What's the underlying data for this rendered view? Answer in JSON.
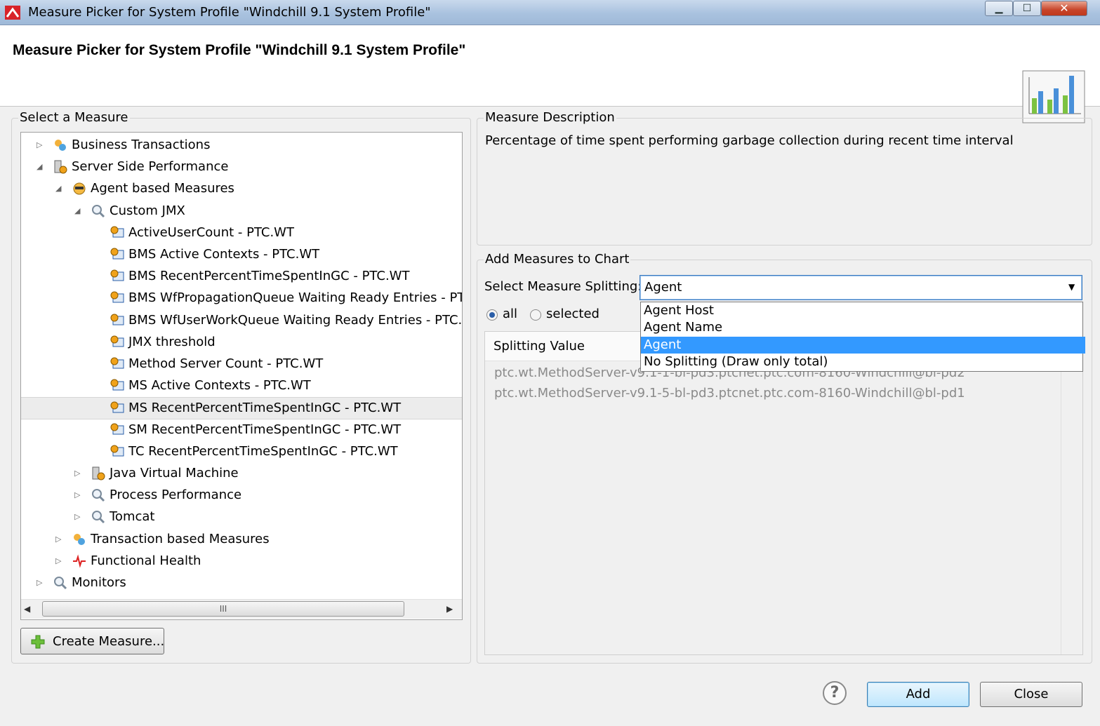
{
  "window": {
    "title": "Measure Picker for System Profile \"Windchill 9.1 System Profile\"",
    "controls": {
      "minimize": "▁",
      "maximize": "☐",
      "close": "✕"
    }
  },
  "header": {
    "title": "Measure Picker for System Profile \"Windchill 9.1 System Profile\"",
    "icon": "bar-chart-icon"
  },
  "select_measure": {
    "label": "Select a Measure",
    "tree": [
      {
        "label": "Business Transactions",
        "icon": "transactions-icon",
        "expanded": false
      },
      {
        "label": "Server Side Performance",
        "icon": "server-icon",
        "expanded": true
      },
      {
        "label": "Agent based Measures",
        "icon": "agent-icon",
        "expanded": true
      },
      {
        "label": "Custom JMX",
        "icon": "magnifier-icon",
        "expanded": true
      },
      {
        "label": "ActiveUserCount - PTC.WT",
        "icon": "jmx-measure-icon"
      },
      {
        "label": "BMS Active Contexts - PTC.WT",
        "icon": "jmx-measure-icon"
      },
      {
        "label": "BMS RecentPercentTimeSpentInGC - PTC.WT",
        "icon": "jmx-measure-icon"
      },
      {
        "label": "BMS WfPropagationQueue Waiting Ready Entries - PTC.WT",
        "icon": "jmx-measure-icon"
      },
      {
        "label": "BMS WfUserWorkQueue Waiting Ready Entries - PTC.WT",
        "icon": "jmx-measure-icon"
      },
      {
        "label": "JMX threshold",
        "icon": "jmx-measure-icon"
      },
      {
        "label": "Method Server Count - PTC.WT",
        "icon": "jmx-measure-icon"
      },
      {
        "label": "MS Active Contexts - PTC.WT",
        "icon": "jmx-measure-icon"
      },
      {
        "label": "MS RecentPercentTimeSpentInGC - PTC.WT",
        "icon": "jmx-measure-icon",
        "selected": true
      },
      {
        "label": "SM RecentPercentTimeSpentInGC - PTC.WT",
        "icon": "jmx-measure-icon"
      },
      {
        "label": "TC RecentPercentTimeSpentInGC - PTC.WT",
        "icon": "jmx-measure-icon"
      },
      {
        "label": "Java Virtual Machine",
        "icon": "server-icon",
        "expanded": false
      },
      {
        "label": "Process Performance",
        "icon": "magnifier-icon",
        "expanded": false
      },
      {
        "label": "Tomcat",
        "icon": "magnifier-icon",
        "expanded": false
      },
      {
        "label": "Transaction based Measures",
        "icon": "transactions-icon",
        "expanded": false
      },
      {
        "label": "Functional Health",
        "icon": "health-icon",
        "expanded": false
      },
      {
        "label": "Monitors",
        "icon": "magnifier-icon",
        "expanded": false
      }
    ],
    "scrollbar_thumb": "III",
    "create_button": "Create Measure..."
  },
  "description": {
    "label": "Measure Description",
    "text": "Percentage of time spent performing garbage collection during recent time interval"
  },
  "add_measures": {
    "label": "Add Measures to Chart",
    "splitting_label": "Select Measure Splitting:",
    "splitting_value": "Agent",
    "options": [
      "Agent Host",
      "Agent Name",
      "Agent",
      "No Splitting (Draw only total)"
    ],
    "highlighted_option": "Agent",
    "radio_all": "all",
    "radio_selected": "selected",
    "radio_checked": "all",
    "column_header": "Splitting Value",
    "values": [
      "ptc.wt.MethodServer-v9.1-1-bl-pd3.ptcnet.ptc.com-8160-Windchill@bl-pd2",
      "ptc.wt.MethodServer-v9.1-5-bl-pd3.ptcnet.ptc.com-8160-Windchill@bl-pd1"
    ]
  },
  "footer": {
    "help": "?",
    "add_button": "Add",
    "close_button": "Close"
  },
  "colors": {
    "accent": "#3399ff",
    "selection": "#ececec",
    "muted_text": "#8a8a8a"
  }
}
